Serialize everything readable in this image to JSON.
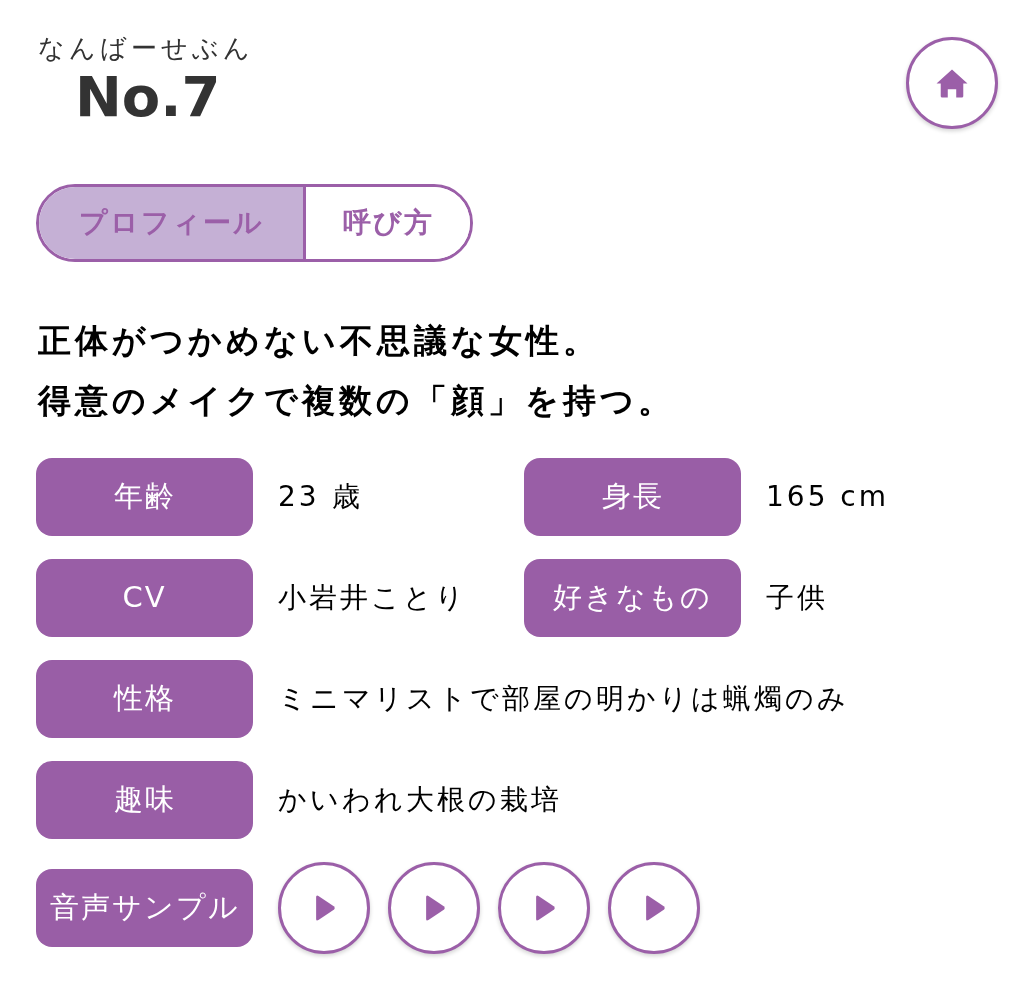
{
  "header": {
    "kana": "なんばーせぶん",
    "number": "No.7"
  },
  "tabs": [
    {
      "label": "プロフィール",
      "selected": true
    },
    {
      "label": "呼び方",
      "selected": false
    }
  ],
  "description": [
    "正体がつかめない不思議な女性。",
    "得意のメイクで複数の「顔」を持つ。"
  ],
  "profile_rows": [
    {
      "fields": [
        {
          "label": "年齢",
          "value": "23 歳"
        },
        {
          "label": "身長",
          "value": "165 cm"
        }
      ]
    },
    {
      "fields": [
        {
          "label": "CV",
          "value": "小岩井ことり"
        },
        {
          "label": "好きなもの",
          "value": "子供"
        }
      ]
    },
    {
      "fields": [
        {
          "label": "性格",
          "value": "ミニマリストで部屋の明かりは蝋燭のみ"
        }
      ]
    },
    {
      "fields": [
        {
          "label": "趣味",
          "value": "かいわれ大根の栽培"
        }
      ]
    }
  ],
  "voice_samples": {
    "label": "音声サンプル",
    "buttons": [
      {
        "playing": false
      },
      {
        "playing": false
      },
      {
        "playing": false
      },
      {
        "playing": false
      }
    ]
  }
}
